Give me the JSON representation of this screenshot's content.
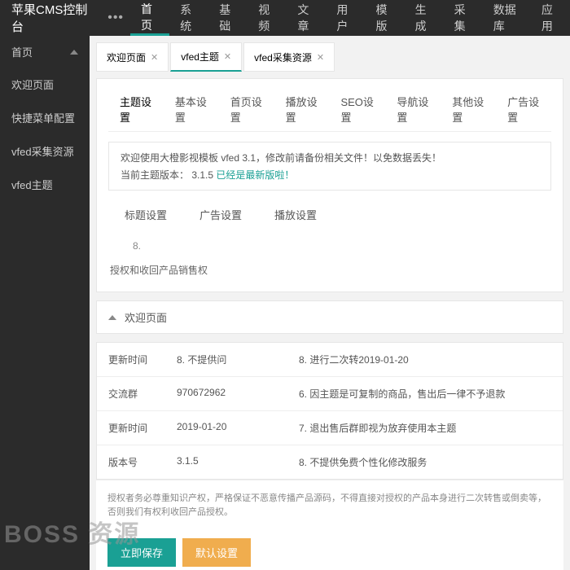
{
  "header": {
    "logo": "苹果CMS控制台",
    "dots": "•••",
    "nav": [
      "首页",
      "系统",
      "基础",
      "视频",
      "文章",
      "用户",
      "模版",
      "生成",
      "采集",
      "数据库",
      "应用"
    ],
    "nav_active": 0
  },
  "sidebar": {
    "head": "首页",
    "items": [
      "欢迎页面",
      "快捷菜单配置",
      "vfed采集资源",
      "vfed主题"
    ]
  },
  "tabs": [
    {
      "label": "欢迎页面",
      "closable": true
    },
    {
      "label": "vfed主题",
      "closable": true,
      "active": true
    },
    {
      "label": "vfed采集资源",
      "closable": true
    }
  ],
  "subtabs": [
    "主题设置",
    "基本设置",
    "首页设置",
    "播放设置",
    "SEO设置",
    "导航设置",
    "其他设置",
    "广告设置"
  ],
  "welcome": {
    "line1": "欢迎使用大橙影视模板 vfed 3.1，修改前请备份相关文件！以免数据丢失！",
    "line2_prefix": "当前主题版本：",
    "version": "3.1.5",
    "latest": "已经是最新版啦！"
  },
  "inner_tabs": [
    "标题设置",
    "广告设置",
    "播放设置"
  ],
  "small_val": "8.",
  "auth_text": "授权和收回产品销售权",
  "collapse": {
    "title": "欢迎页面"
  },
  "info": {
    "rows": [
      {
        "label": "更新时间",
        "val": "8. 不提供问",
        "right": "8. 进行二次转2019-01-20"
      },
      {
        "label": "交流群",
        "val": "970672962",
        "right": "6. 因主题是可复制的商品，售出后一律不予退款"
      },
      {
        "label": "更新时间",
        "val": "2019-01-20",
        "right": "7. 退出售后群即视为放弃使用本主题"
      },
      {
        "label": "版本号",
        "val": "3.1.5",
        "right": "8. 不提供免费个性化修改服务"
      }
    ],
    "footer": "授权者务必尊重知识产权，严格保证不恶意传播产品源码，不得直接对授权的产品本身进行二次转售或倒卖等，否则我们有权利收回产品授权。"
  },
  "buttons": {
    "save": "立即保存",
    "reset": "默认设置"
  },
  "watermark": "BOSS 资源"
}
